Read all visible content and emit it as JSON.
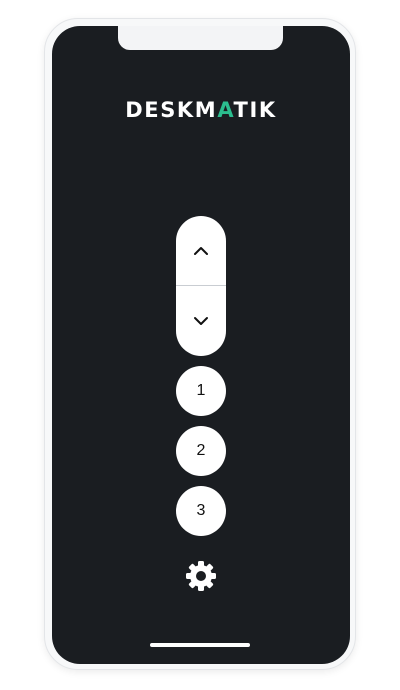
{
  "app": {
    "logo_left": "DESKM",
    "logo_accent": "A",
    "logo_right": "TIK",
    "accent_color": "#2bbd8e",
    "background_color": "#1a1d21"
  },
  "controls": {
    "up_icon": "chevron-up-icon",
    "down_icon": "chevron-down-icon",
    "presets": [
      "1",
      "2",
      "3"
    ],
    "settings_icon": "gear-icon"
  }
}
